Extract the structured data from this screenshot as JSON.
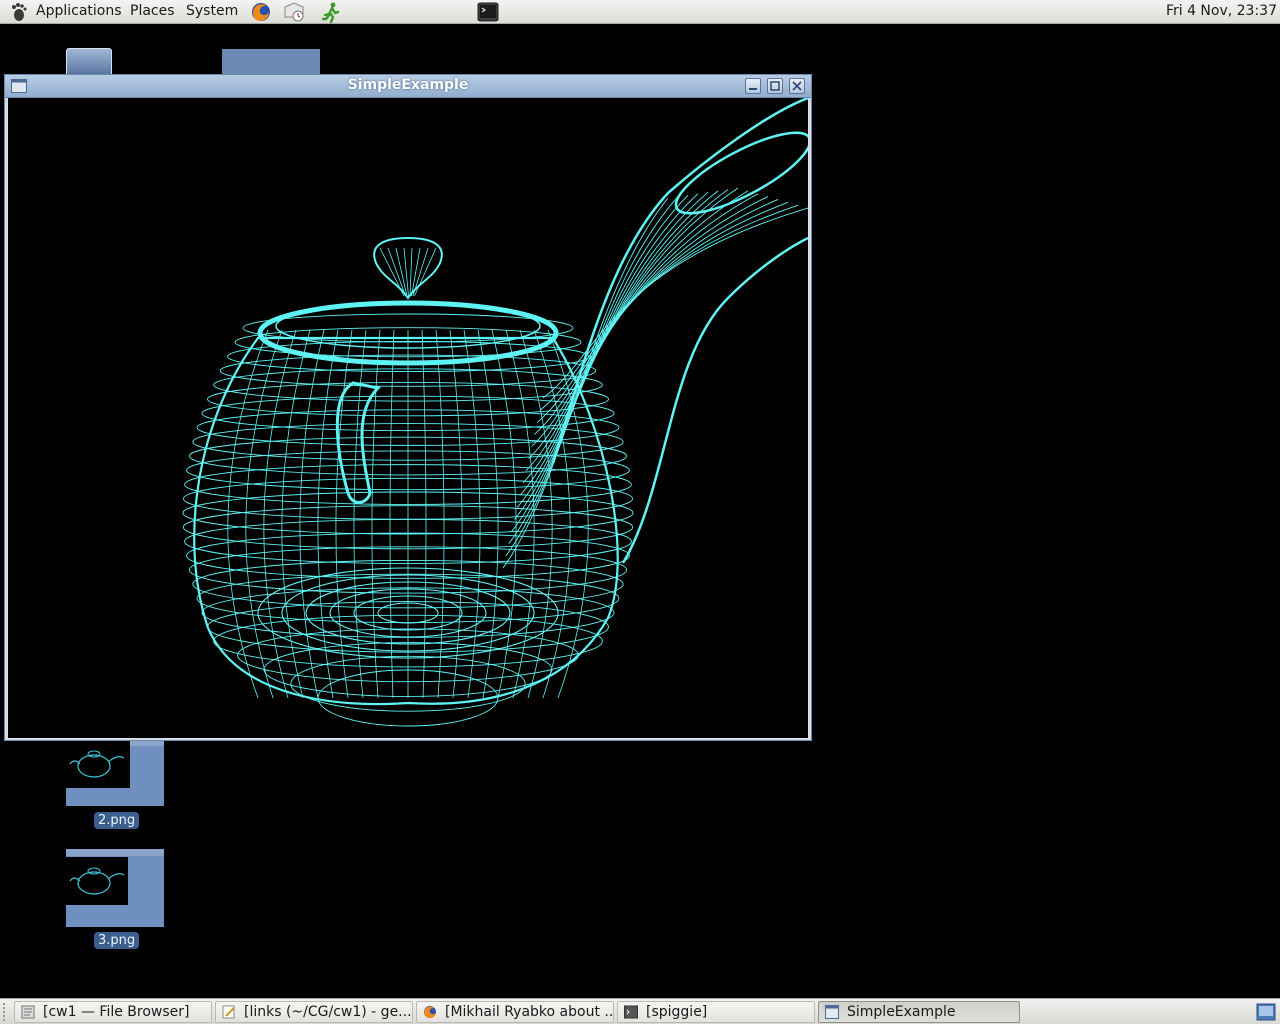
{
  "top_panel": {
    "menus": [
      "Applications",
      "Places",
      "System"
    ],
    "launchers": [
      "firefox-icon",
      "mail-clock-icon",
      "running-man-icon"
    ],
    "terminal_applet": "terminal-icon",
    "clock": "Fri  4 Nov, 23:37"
  },
  "desktop": {
    "icons": [
      {
        "label": "2.png"
      },
      {
        "label": "3.png"
      }
    ]
  },
  "window": {
    "title": "SimpleExample",
    "content": "wireframe-teapot",
    "wire_color": "#5ff4f4"
  },
  "taskbar": {
    "items": [
      {
        "label": "[cw1 — File Browser]",
        "icon": "file-browser-icon",
        "active": false
      },
      {
        "label": "[links (~/CG/cw1) - ge...",
        "icon": "text-editor-icon",
        "active": false
      },
      {
        "label": "[Mikhail Ryabko about ...",
        "icon": "firefox-icon",
        "active": false
      },
      {
        "label": "[spiggie]",
        "icon": "terminal-icon",
        "active": false
      },
      {
        "label": "SimpleExample",
        "icon": "window-icon",
        "active": true
      }
    ],
    "show_desktop_icon": "workspace-icon"
  }
}
